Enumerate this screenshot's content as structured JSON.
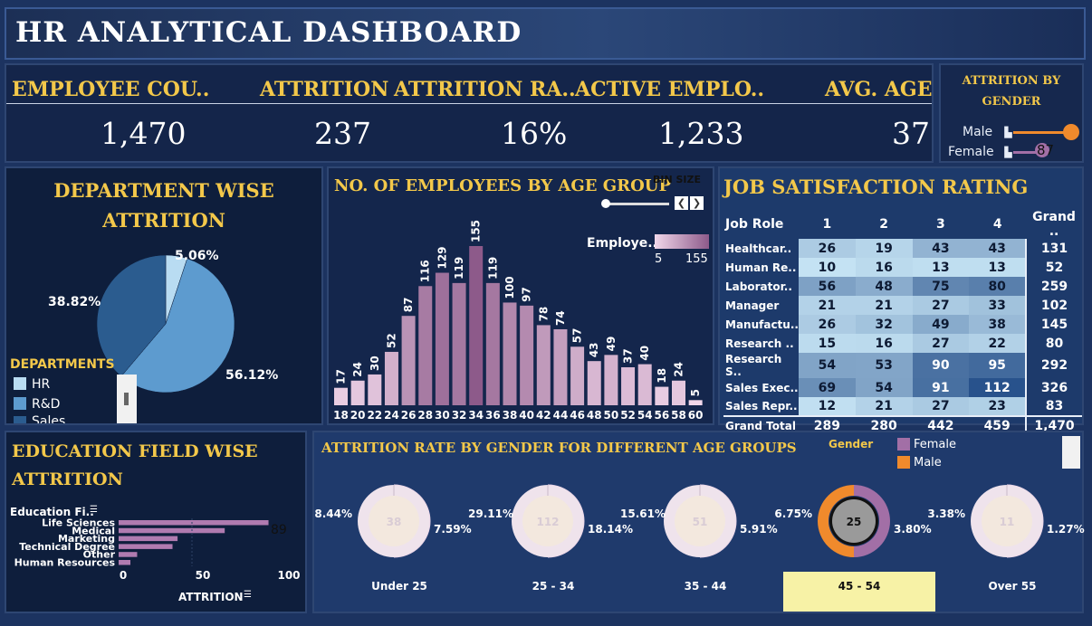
{
  "header": {
    "title": "HR ANALYTICAL DASHBOARD"
  },
  "kpis": [
    {
      "label": "EMPLOYEE COU..",
      "value": "1,470"
    },
    {
      "label": "ATTRITION",
      "value": "237"
    },
    {
      "label": "ATTRITION RA..",
      "value": "16%"
    },
    {
      "label": "ACTIVE EMPLO..",
      "value": "1,233"
    },
    {
      "label": "AVG. AGE",
      "value": "37"
    }
  ],
  "gender_filter": {
    "title_line1": "ATTRITION BY",
    "title_line2": "GENDER",
    "male_label": "Male",
    "female_label": "Female",
    "female_value": "87",
    "male_value_visible": false
  },
  "department": {
    "title_line1": "DEPARTMENT WISE",
    "title_line2": "ATTRITION",
    "legend_title": "DEPARTMENTS",
    "legend": [
      "HR",
      "R&D",
      "Sales"
    ],
    "colors": [
      "#b9dcf2",
      "#2b5c8f",
      "#5d9bcf"
    ],
    "labels": [
      "5.06%",
      "56.12%",
      "38.82%"
    ]
  },
  "age_group": {
    "title": "NO. OF EMPLOYEES BY AGE GROUP",
    "bin_size_label": "BIN SIZE",
    "legend_title": "Employe..",
    "legend_min": "5",
    "legend_max": "155"
  },
  "job_satisfaction": {
    "title": "JOB SATISFACTION RATING",
    "columns": [
      "Job Role",
      "1",
      "2",
      "3",
      "4",
      "Grand .."
    ],
    "rows": [
      {
        "role": "Healthcar..",
        "v": [
          "26",
          "19",
          "43",
          "43"
        ],
        "total": "131"
      },
      {
        "role": "Human Re..",
        "v": [
          "10",
          "16",
          "13",
          "13"
        ],
        "total": "52"
      },
      {
        "role": "Laborator..",
        "v": [
          "56",
          "48",
          "75",
          "80"
        ],
        "total": "259"
      },
      {
        "role": "Manager",
        "v": [
          "21",
          "21",
          "27",
          "33"
        ],
        "total": "102"
      },
      {
        "role": "Manufactu..",
        "v": [
          "26",
          "32",
          "49",
          "38"
        ],
        "total": "145"
      },
      {
        "role": "Research ..",
        "v": [
          "15",
          "16",
          "27",
          "22"
        ],
        "total": "80"
      },
      {
        "role": "Research S..",
        "v": [
          "54",
          "53",
          "90",
          "95"
        ],
        "total": "292"
      },
      {
        "role": "Sales Exec..",
        "v": [
          "69",
          "54",
          "91",
          "112"
        ],
        "total": "326"
      },
      {
        "role": "Sales Repr..",
        "v": [
          "12",
          "21",
          "27",
          "23"
        ],
        "total": "83"
      }
    ],
    "grand_total": {
      "role": "Grand Total",
      "v": [
        "289",
        "280",
        "442",
        "459"
      ],
      "total": "1,470"
    }
  },
  "education": {
    "title_line1": "EDUCATION FIELD WISE",
    "title_line2": "ATTRITION",
    "field_header": "Education Fi..",
    "axis_label": "ATTRITION",
    "hover_value": "89"
  },
  "attrition_gender_age": {
    "title": "ATTRITION RATE BY GENDER FOR DIFFERENT AGE GROUPS",
    "legend_title": "Gender",
    "legend": [
      {
        "name": "Female",
        "color": "#a26fa6"
      },
      {
        "name": "Male",
        "color": "#f08a2c"
      }
    ],
    "groups": [
      {
        "label": "Under 25",
        "center": "38",
        "left": "8.44%",
        "right": "7.59%",
        "highlight": false
      },
      {
        "label": "25 - 34",
        "center": "112",
        "left": "29.11%",
        "right": "18.14%",
        "highlight": false
      },
      {
        "label": "35 - 44",
        "center": "51",
        "left": "15.61%",
        "right": "5.91%",
        "highlight": false
      },
      {
        "label": "45 - 54",
        "center": "25",
        "left": "6.75%",
        "right": "3.80%",
        "highlight": true
      },
      {
        "label": "Over 55",
        "center": "11",
        "left": "3.38%",
        "right": "1.27%",
        "highlight": false
      }
    ]
  },
  "chart_data": [
    {
      "type": "pie",
      "title": "DEPARTMENT WISE ATTRITION",
      "categories": [
        "HR",
        "R&D",
        "Sales"
      ],
      "values": [
        5.06,
        56.12,
        38.82
      ]
    },
    {
      "type": "bar",
      "title": "NO. OF EMPLOYEES BY AGE GROUP",
      "categories": [
        "18",
        "20",
        "22",
        "24",
        "26",
        "28",
        "30",
        "32",
        "34",
        "36",
        "38",
        "40",
        "42",
        "44",
        "46",
        "48",
        "50",
        "52",
        "54",
        "56",
        "58",
        "60"
      ],
      "values": [
        17,
        24,
        30,
        52,
        87,
        116,
        129,
        119,
        155,
        119,
        100,
        97,
        78,
        74,
        57,
        43,
        49,
        37,
        40,
        18,
        24,
        5
      ],
      "ylim": [
        0,
        155
      ]
    },
    {
      "type": "bar",
      "title": "EDUCATION FIELD WISE ATTRITION",
      "orientation": "horizontal",
      "categories": [
        "Life Sciences",
        "Medical",
        "Marketing",
        "Technical Degree",
        "Other",
        "Human Resources"
      ],
      "values": [
        89,
        63,
        35,
        32,
        11,
        7
      ],
      "xlabel": "ATTRITION",
      "xticks": [
        "0",
        "50",
        "100"
      ],
      "xlim": [
        0,
        100
      ]
    }
  ]
}
